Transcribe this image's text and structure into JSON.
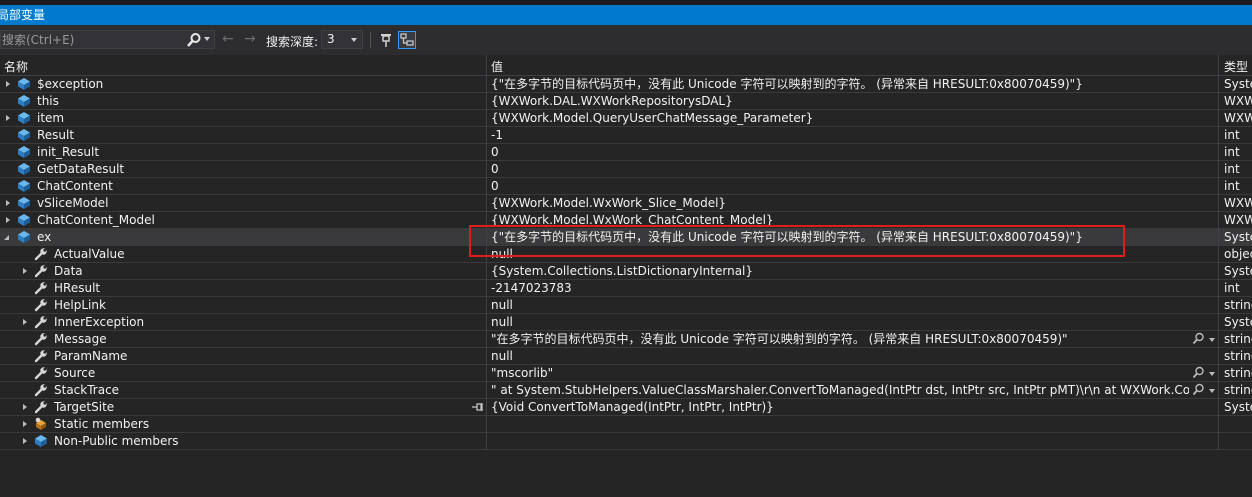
{
  "window": {
    "title": "局部变量"
  },
  "toolbar": {
    "search_placeholder": "搜索(Ctrl+E)",
    "depth_label": "搜索深度:",
    "depth_value": "3"
  },
  "columns": {
    "name": "名称",
    "value": "值",
    "type": "类型"
  },
  "rows": [
    {
      "name": "$exception",
      "value": "{\"在多字节的目标代码页中，没有此 Unicode 字符可以映射到的字符。 (异常来自 HRESULT:0x80070459)\"}",
      "type": "System"
    },
    {
      "name": "this",
      "value": "{WXWork.DAL.WXWorkRepositorysDAL}",
      "type": "WXW"
    },
    {
      "name": "item",
      "value": "{WXWork.Model.QueryUserChatMessage_Parameter}",
      "type": "WXW"
    },
    {
      "name": "Result",
      "value": "-1",
      "type": "int"
    },
    {
      "name": "init_Result",
      "value": "0",
      "type": "int"
    },
    {
      "name": "GetDataResult",
      "value": "0",
      "type": "int"
    },
    {
      "name": "ChatContent",
      "value": "0",
      "type": "int"
    },
    {
      "name": "vSliceModel",
      "value": "{WXWork.Model.WxWork_Slice_Model}",
      "type": "WXW"
    },
    {
      "name": "ChatContent_Model",
      "value": "{WXWork.Model.WxWork_ChatContent_Model}",
      "type": "WXW"
    },
    {
      "name": "ex",
      "value": "{\"在多字节的目标代码页中，没有此 Unicode 字符可以映射到的字符。 (异常来自 HRESULT:0x80070459)\"}",
      "type": "Syste"
    },
    {
      "name": "ActualValue",
      "value": "null",
      "type": "objec"
    },
    {
      "name": "Data",
      "value": "{System.Collections.ListDictionaryInternal}",
      "type": "Syste"
    },
    {
      "name": "HResult",
      "value": "-2147023783",
      "type": "int"
    },
    {
      "name": "HelpLink",
      "value": "null",
      "type": "string"
    },
    {
      "name": "InnerException",
      "value": "null",
      "type": "Syste"
    },
    {
      "name": "Message",
      "value": "\"在多字节的目标代码页中，没有此 Unicode 字符可以映射到的字符。 (异常来自 HRESULT:0x80070459)\"",
      "type": "string"
    },
    {
      "name": "ParamName",
      "value": "null",
      "type": "string"
    },
    {
      "name": "Source",
      "value": "\"mscorlib\"",
      "type": "string"
    },
    {
      "name": "StackTrace",
      "value": "\"   at System.StubHelpers.ValueClassMarshaler.ConvertToManaged(IntPtr dst, IntPtr src, IntPtr pMT)\\r\\n   at WXWork.Common.Wx...",
      "type": "string"
    },
    {
      "name": "TargetSite",
      "value": "{Void ConvertToManaged(IntPtr, IntPtr, IntPtr)}",
      "type": "Syste"
    },
    {
      "name": "Static members",
      "value": "",
      "type": ""
    },
    {
      "name": "Non-Public members",
      "value": "",
      "type": ""
    }
  ],
  "colors": {
    "accent": "#007acc",
    "background": "#252526",
    "highlight_border": "#e01d1d",
    "variable_icon": "#4aa3df",
    "property_icon": "#cccccc"
  }
}
